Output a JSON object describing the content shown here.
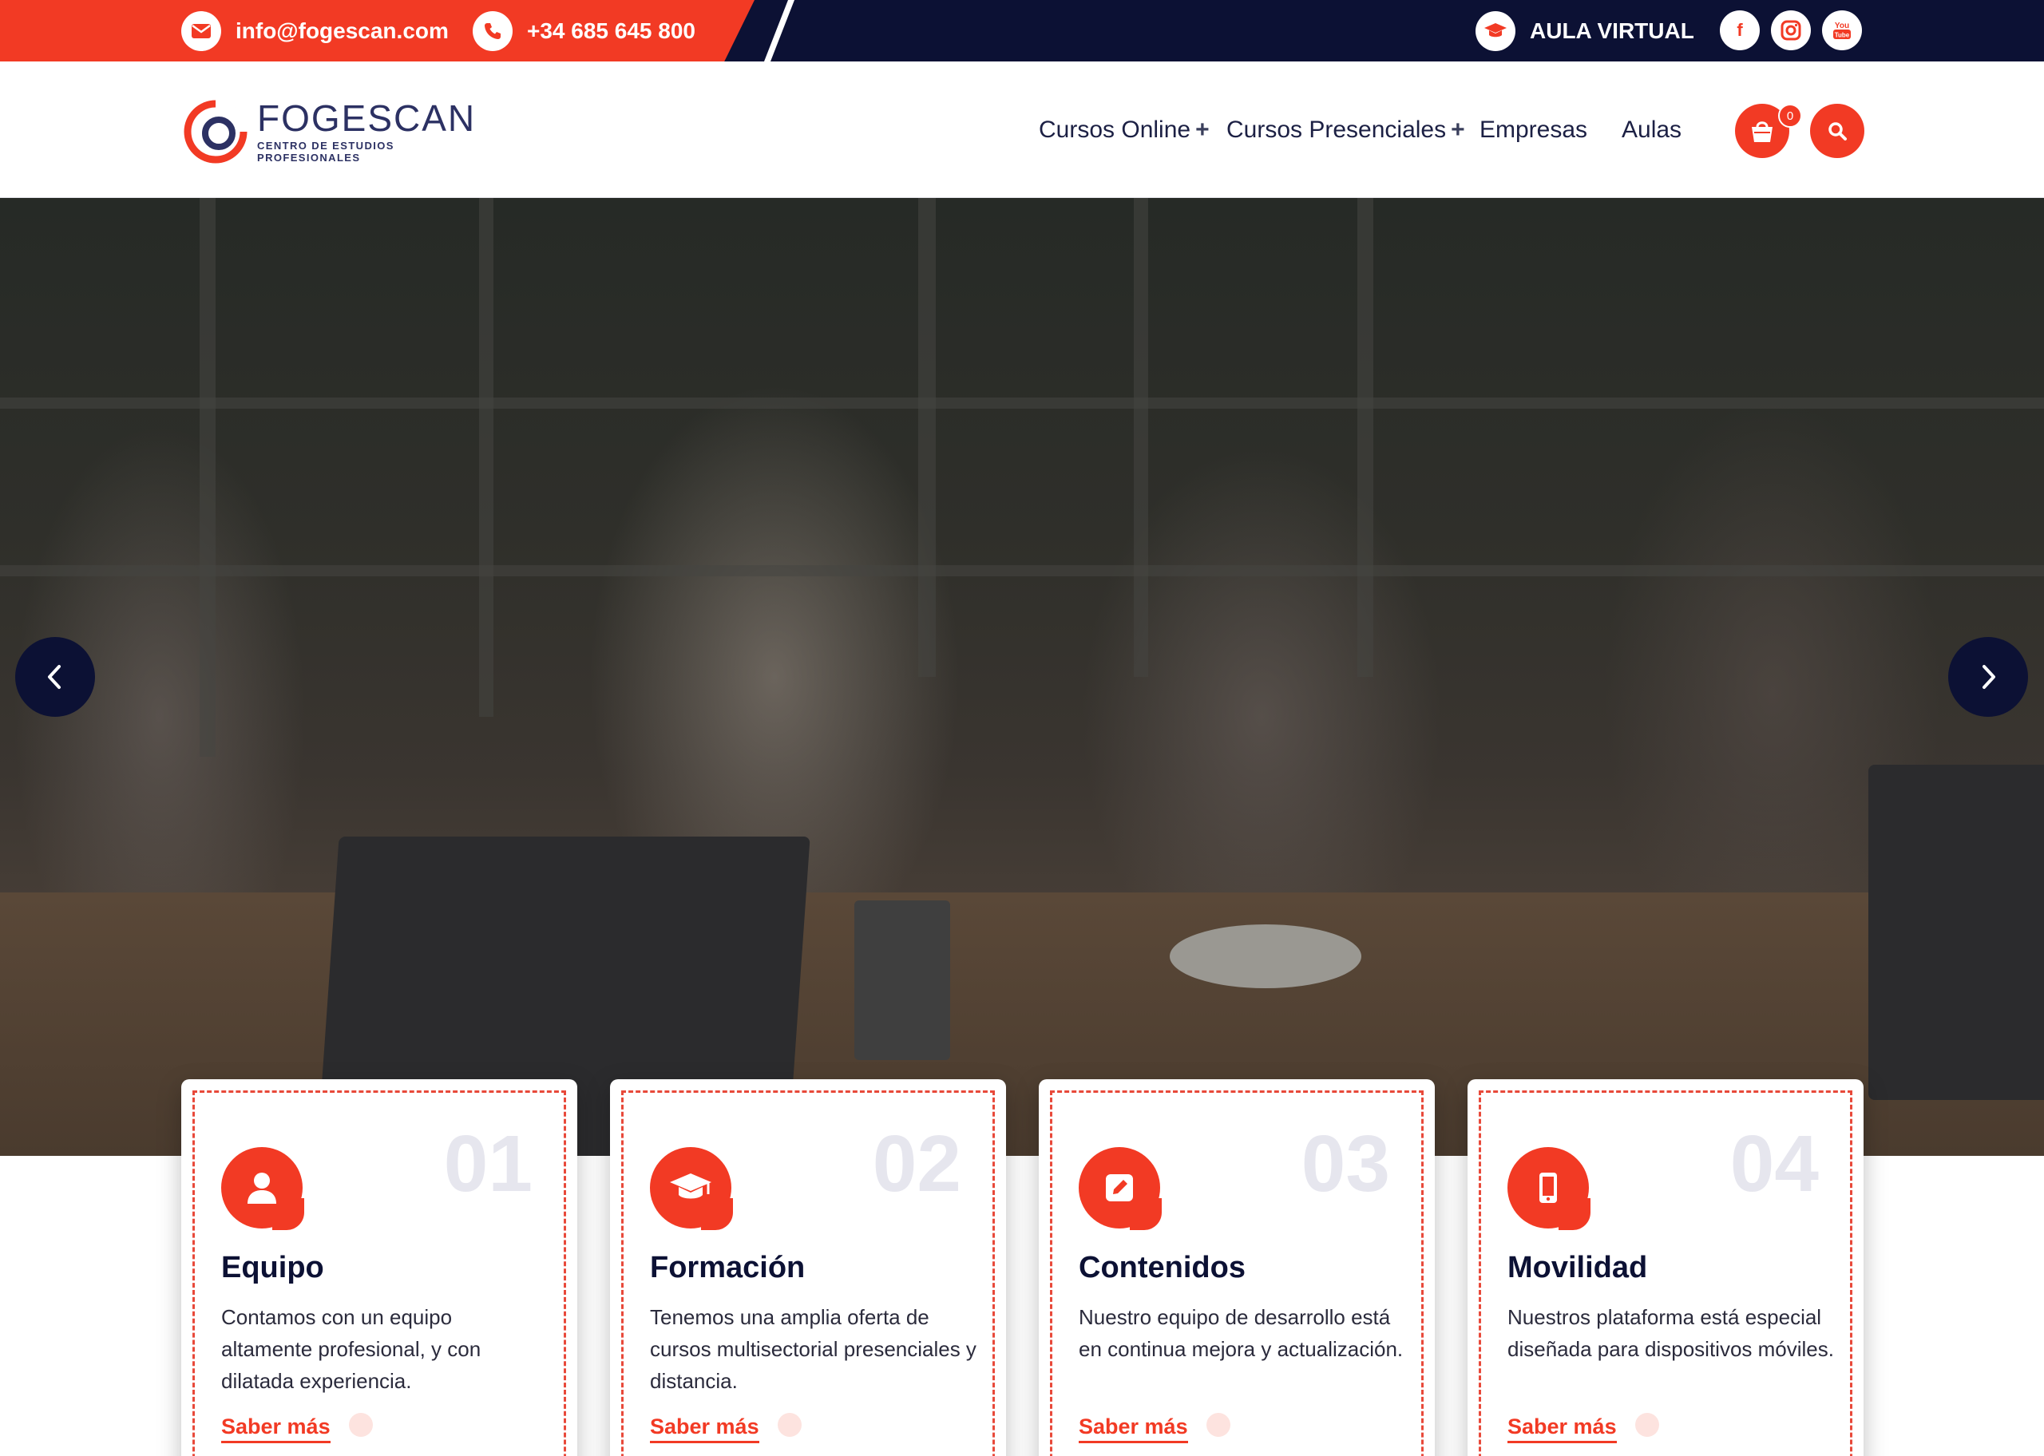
{
  "topbar": {
    "email": "info@fogescan.com",
    "phone": "+34 685 645 800",
    "aula_virtual": "AULA VIRTUAL",
    "social": [
      {
        "icon": "facebook-icon",
        "glyph": "f"
      },
      {
        "icon": "instagram-icon",
        "glyph": "◎"
      },
      {
        "icon": "youtube-icon",
        "glyph": "You\nTube"
      }
    ]
  },
  "header": {
    "logo": {
      "name": "FOGESCAN",
      "subtitle_line1": "CENTRO DE ESTUDIOS",
      "subtitle_line2": "PROFESIONALES"
    },
    "nav": [
      {
        "label": "Cursos Online",
        "has_submenu": true,
        "plus": "+"
      },
      {
        "label": "Cursos Presenciales",
        "has_submenu": true,
        "plus": "+"
      },
      {
        "label": "Empresas",
        "has_submenu": false
      },
      {
        "label": "Aulas",
        "has_submenu": false
      }
    ],
    "cart_count": "0",
    "cart_icon": "shopping-bag-icon",
    "search_icon": "search-icon"
  },
  "hero": {
    "prev_icon": "chevron-left-icon",
    "next_icon": "chevron-right-icon"
  },
  "cards": [
    {
      "number": "01",
      "title": "Equipo",
      "text": "Contamos con un equipo altamente profesional, y con dilatada experiencia.",
      "link": "Saber más",
      "icon": "user-icon"
    },
    {
      "number": "02",
      "title": "Formación",
      "text": "Tenemos una amplia oferta de cursos multisectorial presenciales y distancia.",
      "link": "Saber más",
      "icon": "graduation-cap-icon"
    },
    {
      "number": "03",
      "title": "Contenidos",
      "text": "Nuestro equipo de desarrollo está en continua mejora y actualización.",
      "link": "Saber más",
      "icon": "edit-icon"
    },
    {
      "number": "04",
      "title": "Movilidad",
      "text": "Nuestros plataforma está especial diseñada para dispositivos móviles.",
      "link": "Saber más",
      "icon": "mobile-icon"
    }
  ],
  "colors": {
    "accent": "#f23a24",
    "navy": "#0c1134"
  }
}
